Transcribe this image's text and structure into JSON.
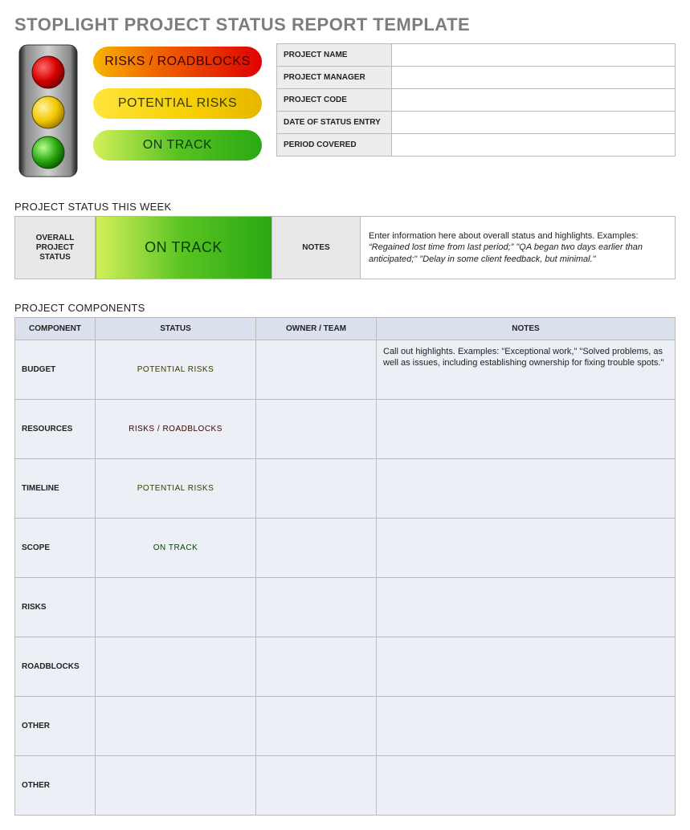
{
  "title": "STOPLIGHT PROJECT STATUS REPORT TEMPLATE",
  "legend": {
    "red": "RISKS / ROADBLOCKS",
    "yellow": "POTENTIAL RISKS",
    "green": "ON TRACK"
  },
  "meta": {
    "fields": [
      {
        "label": "PROJECT NAME",
        "value": ""
      },
      {
        "label": "PROJECT MANAGER",
        "value": ""
      },
      {
        "label": "PROJECT CODE",
        "value": ""
      },
      {
        "label": "DATE OF STATUS ENTRY",
        "value": ""
      },
      {
        "label": "PERIOD COVERED",
        "value": ""
      }
    ]
  },
  "status_week": {
    "heading": "PROJECT STATUS THIS WEEK",
    "overall_label": "OVERALL PROJECT STATUS",
    "overall_status_text": "ON TRACK",
    "overall_status_level": "green",
    "notes_label": "NOTES",
    "notes_prefix": "Enter information here about overall status and highlights. Examples: ",
    "notes_italic": "“Regained lost time from last period;” \"QA began two days earlier than anticipated;\" \"Delay in some client feedback, but minimal.\""
  },
  "components": {
    "heading": "PROJECT COMPONENTS",
    "columns": [
      "COMPONENT",
      "STATUS",
      "OWNER / TEAM",
      "NOTES"
    ],
    "rows": [
      {
        "component": "BUDGET",
        "status_text": "POTENTIAL RISKS",
        "status_level": "yellow",
        "owner": "",
        "notes": "Call out highlights. Examples: \"Exceptional work,\" \"Solved problems, as well as issues, including establishing ownership for fixing trouble spots.\""
      },
      {
        "component": "RESOURCES",
        "status_text": "RISKS / ROADBLOCKS",
        "status_level": "red",
        "owner": "",
        "notes": ""
      },
      {
        "component": "TIMELINE",
        "status_text": "POTENTIAL RISKS",
        "status_level": "yellow",
        "owner": "",
        "notes": ""
      },
      {
        "component": "SCOPE",
        "status_text": "ON TRACK",
        "status_level": "green",
        "owner": "",
        "notes": ""
      },
      {
        "component": "RISKS",
        "status_text": "",
        "status_level": "",
        "owner": "",
        "notes": ""
      },
      {
        "component": "ROADBLOCKS",
        "status_text": "",
        "status_level": "",
        "owner": "",
        "notes": ""
      },
      {
        "component": "OTHER",
        "status_text": "",
        "status_level": "",
        "owner": "",
        "notes": ""
      },
      {
        "component": "OTHER",
        "status_text": "",
        "status_level": "",
        "owner": "",
        "notes": ""
      }
    ]
  },
  "colors": {
    "green_light": "#d4f05a",
    "green_dark": "#2aa813",
    "yellow_light": "#ffe43a",
    "yellow_dark": "#e6b600",
    "red_light": "#f7b500",
    "red_dark": "#e00000"
  }
}
